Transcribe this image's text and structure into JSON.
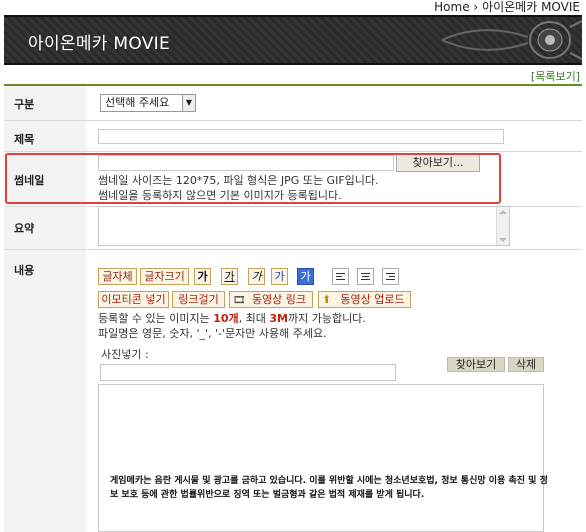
{
  "breadcrumb": {
    "home": "Home",
    "sep": "›",
    "current": "아이온메카 MOVIE"
  },
  "banner": {
    "title": "아이온메카 MOVIE"
  },
  "list_link": "[목록보기]",
  "form": {
    "category": {
      "label": "구분",
      "selected": "선택해 주세요"
    },
    "title": {
      "label": "제목",
      "value": ""
    },
    "thumbnail": {
      "label": "썸네일",
      "browse_button": "찾아보기...",
      "note_line1": "썸네일 사이즈는 120*75, 파일 형식은 JPG 또는 GIF입니다.",
      "note_line2": "썸네일을 등록하지 않으면 기본 이미지가 등록됩니다."
    },
    "summary": {
      "label": "요약",
      "value": ""
    },
    "content": {
      "label": "내용",
      "toolbar_row1": [
        "글자체",
        "글자크기"
      ],
      "format_buttons": [
        "가",
        "가",
        "가",
        "가",
        "가"
      ],
      "toolbar_row2": [
        "이모티콘 넣기",
        "링크걸기",
        "동영상 링크",
        "동영상 업로드"
      ],
      "info_line1_a": "등록할 수 있는 이미지는 ",
      "info_line1_b": "10개",
      "info_line1_c": ", 최대 ",
      "info_line1_d": "3M",
      "info_line1_e": "까지 가능합니다.",
      "info_line2": "파일명은 영문, 숫자, '_', '-'문자만 사용해 주세요.",
      "photo_label": "사진넣기 :",
      "photo_browse": "찾아보기",
      "photo_delete": "삭제",
      "notice": "게임메카는 음란 게시물 및 광고를 금하고 있습니다. 이를 위반할 시에는 청소년보호법, 정보 통신망 이용 촉진 및 정보 보호 등에 관한 법률위반으로 징역 또는 벌금형과 같은 법적 제재를 받게 됩니다."
    }
  },
  "colors": {
    "accent_red": "#e0413e",
    "link_green": "#3a7a2a",
    "banner_bg": "#2c2c2c"
  }
}
